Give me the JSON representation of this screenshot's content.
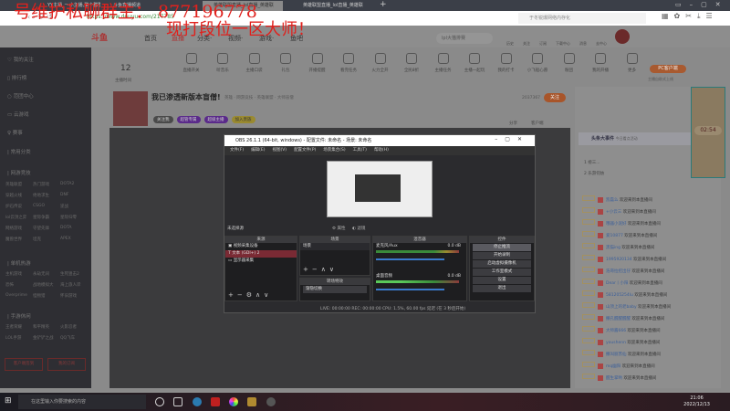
{
  "browser": {
    "tabs": [
      "YY主播_一小主播,聚个群群",
      "斗鱼直播频道",
      "英雄联盟直播_lol直播_英雄联",
      "英雄联盟直播_lol直播_英雄联"
    ],
    "url": "https://www.douyu.com/217785",
    "search_placeholder": "于冬锐爆网络内存化"
  },
  "overlay": {
    "line1": "号维护私聊群主： 877196778",
    "line2": "现打段位一区大师！"
  },
  "header": {
    "logo": "斗鱼",
    "nav": [
      "首页",
      "直播",
      "分类·",
      "视频·",
      "游戏·",
      "鱼吧"
    ],
    "search_placeholder": "lpl大猫排赛",
    "icons": [
      "历史",
      "关注",
      "订阅",
      "下载中心",
      "消息",
      "去中心"
    ]
  },
  "sidebar": {
    "items": [
      "我的关注",
      "排行榜",
      "范团中心",
      "云游戏",
      "赛事"
    ],
    "sections": [
      {
        "title": "常用分类",
        "more": "展开",
        "games": []
      },
      {
        "title": "网游竞技",
        "more": "全部",
        "games": [
          "英雄联盟",
          "热门游戏",
          "DOTA2",
          "穿越火线",
          "绝地求生",
          "DNF",
          "炉石传说",
          "CSGO",
          "逆战",
          "lol云顶之弈",
          "星际争霸",
          "星际归零",
          "网络游戏",
          "守望先锋",
          "DOTA",
          "魔兽世界",
          "坦克",
          "APEX"
        ]
      },
      {
        "title": "单机热游",
        "more": "全部",
        "games": [
          "主机游戏",
          "永劫无间",
          "生死狙击2",
          "恐怖",
          "战地模拟大",
          "海上旅人岸",
          "Overprime",
          "怪物猎",
          "怀旧游戏"
        ]
      },
      {
        "title": "手游休闲",
        "more": "全部",
        "games": [
          "王者荣耀",
          "和平精英",
          "火影忍者",
          "LOL手游",
          "金铲铲之战",
          "QQ飞车"
        ]
      }
    ],
    "buttons": [
      "客户端签到",
      "我的订阅"
    ]
  },
  "iconrow": {
    "count": "12",
    "items": [
      "主播时间",
      "直播开关",
      "听音乐",
      "主播口袋",
      "礼包",
      "开播提醒",
      "看完任务",
      "火力全开",
      "全民8折",
      "主播任务",
      "主播一起玩",
      "我的打卡",
      "小飞船心愿",
      "粉团",
      "我的开播",
      "更多"
    ],
    "pc_label": "PC客户端",
    "pc_sub": "主播自助式上线"
  },
  "streamer": {
    "title": "我已渗透新版本盲僧!",
    "tags": "英雄 · 网游竞技 · 英雄联盟 · 大师盲僧",
    "id": "2037367",
    "follow": "关注",
    "badges": [
      "关注我",
      "超管专属",
      "超级主播",
      "加入贵族"
    ],
    "share": "分享",
    "client": "客户端"
  },
  "obs": {
    "title": "OBS 26.1.1 (64-bit, windows) - 配置文件: 未命名 - 场景: 未命名",
    "menu": [
      "文件(F)",
      "编辑(E)",
      "视图(V)",
      "配置文件(P)",
      "场景集合(S)",
      "工具(T)",
      "帮助(H)"
    ],
    "no_source": "未选择源",
    "props": "属性",
    "filters": "滤镜",
    "panels": {
      "sources": "来源",
      "scenes": "场景",
      "mixer": "混音器",
      "transitions": "转场特效",
      "controls": "控件"
    },
    "sources": [
      "视频采集设备",
      "文本 (GDI+) 2",
      "显示器采集"
    ],
    "scenes": [
      "场景"
    ],
    "mixer": [
      {
        "name": "麦克风/Aux",
        "db": "0.0 dB"
      },
      {
        "name": "桌面音频",
        "db": "0.0 dB"
      }
    ],
    "transition": "渐隐切换",
    "controls": [
      "停止推流",
      "开始录制",
      "启动虚拟摄像机",
      "工作室模式",
      "设置",
      "退出"
    ],
    "status": "LIVE: 00:00:00   REC: 00:00:00   CPU: 1.5%, 60.00 fps   延迟 (在 3 秒后开始)"
  },
  "chat": {
    "event_title": "头条大事件",
    "event_sub": "今日看点活动",
    "timer": "02:54",
    "ranks": [
      "榜三...",
      "乐游何妨"
    ],
    "messages": [
      {
        "n": "凯磊么"
      },
      {
        "n": "+小云三"
      },
      {
        "n": "哦器小泥好"
      },
      {
        "n": "爱10877"
      },
      {
        "n": "黑猫ing"
      },
      {
        "n": "1995920134"
      },
      {
        "n": "浩哥拉挖出仔"
      },
      {
        "n": "Dear丨小阳"
      },
      {
        "n": "581205254lu"
      },
      {
        "n": "山顶上的老baby"
      },
      {
        "n": "撒孔醒醒醒醒"
      },
      {
        "n": "大师酱666"
      },
      {
        "n": "youshenn"
      },
      {
        "n": "撒叫丽苏仙"
      },
      {
        "n": "mq幽阳"
      },
      {
        "n": "醒生掌哟"
      }
    ],
    "welcome": "欢迎来到本直播间"
  },
  "taskbar": {
    "search": "在这里输入你要搜索的内容",
    "time": "21:06",
    "date": "2022/12/13"
  }
}
